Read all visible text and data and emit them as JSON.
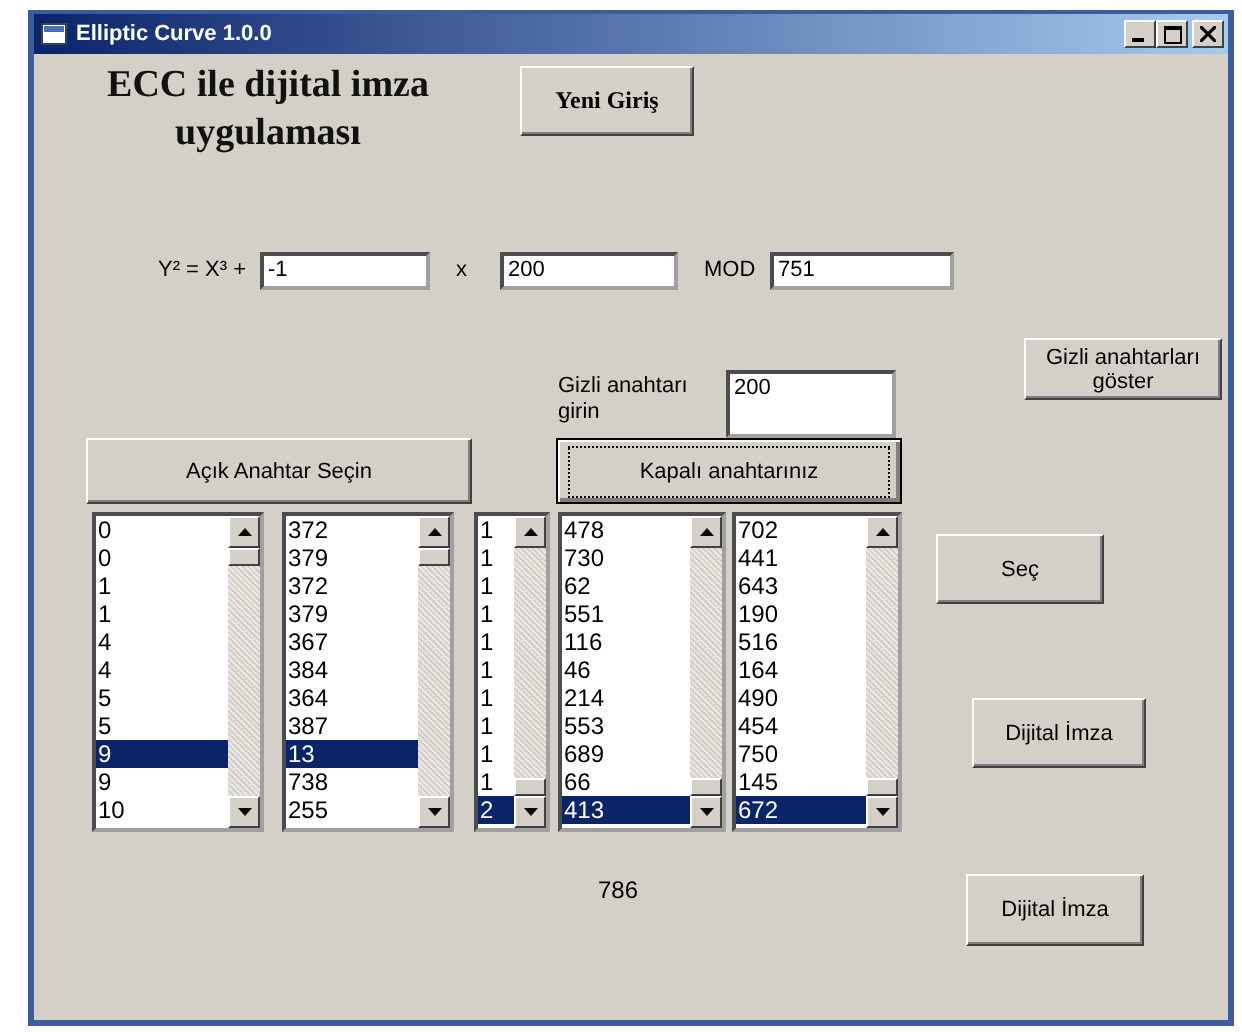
{
  "window": {
    "title": "Elliptic Curve 1.0.0"
  },
  "heading": "ECC ile dijital imza uygulaması",
  "new_entry_button": "Yeni Giriş",
  "equation": {
    "label": "Y² = X³ +",
    "a": "-1",
    "x_label": "x",
    "b": "200",
    "mod_label": "MOD",
    "mod": "751"
  },
  "show_private_keys_button": "Gizli anahtarları göster",
  "private_key": {
    "label": "Gizli anahtarı girin",
    "value": "200"
  },
  "public_key_button": {
    "label": "Açık Anahtar Seçin",
    "focused": false
  },
  "private_key_button": {
    "label": "Kapalı anahtarınız",
    "focused": true
  },
  "lists": [
    {
      "items": [
        {
          "text": "0",
          "selected": false
        },
        {
          "text": "0",
          "selected": false
        },
        {
          "text": "1",
          "selected": false
        },
        {
          "text": "1",
          "selected": false
        },
        {
          "text": "4",
          "selected": false
        },
        {
          "text": "4",
          "selected": false
        },
        {
          "text": "5",
          "selected": false
        },
        {
          "text": "5",
          "selected": false
        },
        {
          "text": "9",
          "selected": true
        },
        {
          "text": "9",
          "selected": false
        },
        {
          "text": "10",
          "selected": false
        }
      ]
    },
    {
      "items": [
        {
          "text": "372",
          "selected": false
        },
        {
          "text": "379",
          "selected": false
        },
        {
          "text": "372",
          "selected": false
        },
        {
          "text": "379",
          "selected": false
        },
        {
          "text": "367",
          "selected": false
        },
        {
          "text": "384",
          "selected": false
        },
        {
          "text": "364",
          "selected": false
        },
        {
          "text": "387",
          "selected": false
        },
        {
          "text": "13",
          "selected": true
        },
        {
          "text": "738",
          "selected": false
        },
        {
          "text": "255",
          "selected": false
        }
      ]
    },
    {
      "items": [
        {
          "text": "1",
          "selected": false
        },
        {
          "text": "1",
          "selected": false
        },
        {
          "text": "1",
          "selected": false
        },
        {
          "text": "1",
          "selected": false
        },
        {
          "text": "1",
          "selected": false
        },
        {
          "text": "1",
          "selected": false
        },
        {
          "text": "1",
          "selected": false
        },
        {
          "text": "1",
          "selected": false
        },
        {
          "text": "1",
          "selected": false
        },
        {
          "text": "1",
          "selected": false
        },
        {
          "text": "2",
          "selected": true
        }
      ]
    },
    {
      "items": [
        {
          "text": "478",
          "selected": false
        },
        {
          "text": "730",
          "selected": false
        },
        {
          "text": "62",
          "selected": false
        },
        {
          "text": "551",
          "selected": false
        },
        {
          "text": "116",
          "selected": false
        },
        {
          "text": "46",
          "selected": false
        },
        {
          "text": "214",
          "selected": false
        },
        {
          "text": "553",
          "selected": false
        },
        {
          "text": "689",
          "selected": false
        },
        {
          "text": "66",
          "selected": false
        },
        {
          "text": "413",
          "selected": true
        }
      ]
    },
    {
      "items": [
        {
          "text": "702",
          "selected": false
        },
        {
          "text": "441",
          "selected": false
        },
        {
          "text": "643",
          "selected": false
        },
        {
          "text": "190",
          "selected": false
        },
        {
          "text": "516",
          "selected": false
        },
        {
          "text": "164",
          "selected": false
        },
        {
          "text": "490",
          "selected": false
        },
        {
          "text": "454",
          "selected": false
        },
        {
          "text": "750",
          "selected": false
        },
        {
          "text": "145",
          "selected": false
        },
        {
          "text": "672",
          "selected": true
        }
      ]
    }
  ],
  "select_button": "Seç",
  "sign_button": "Dijital İmza",
  "result": "786",
  "sign_button_2": "Dijital İmza"
}
